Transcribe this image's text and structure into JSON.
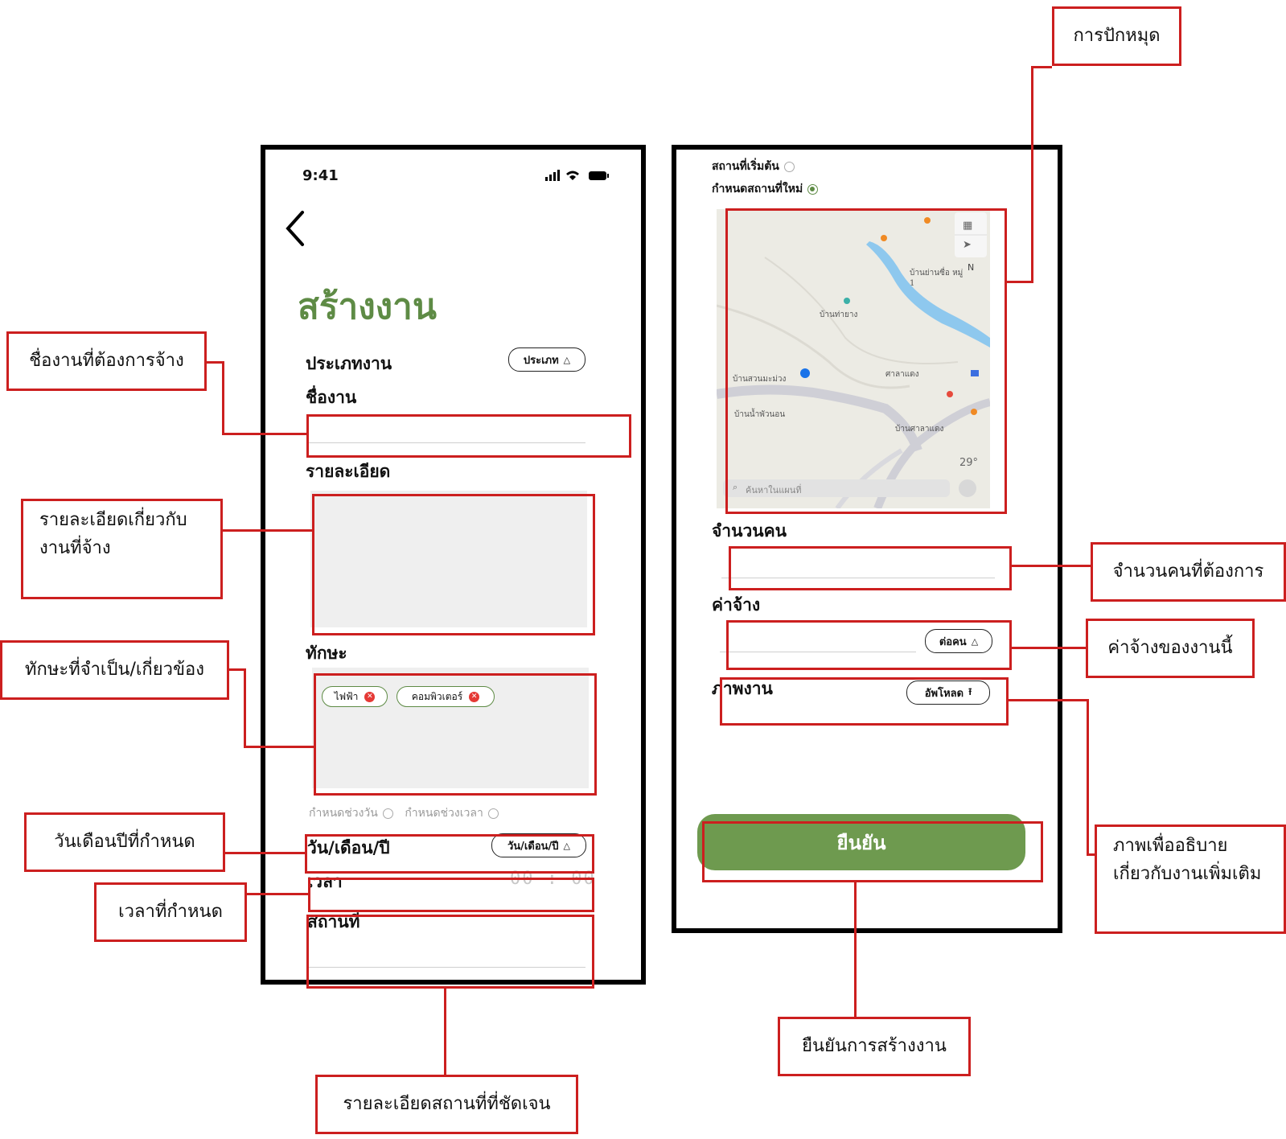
{
  "left_phone": {
    "status_time": "9:41",
    "title": "สร้างงาน",
    "job_type_label": "ประเภทงาน",
    "job_type_pill": "ประเภท",
    "job_name_label": "ชื่องาน",
    "details_label": "รายละเอียด",
    "skills_label": "ทักษะ",
    "skills": [
      "ไฟฟ้า",
      "คอมพิวเตอร์"
    ],
    "range_date_option": "กำหนดช่วงวัน",
    "range_time_option": "กำหนดช่วงเวลา",
    "date_label": "วัน/เดือน/ปี",
    "date_pill": "วัน/เดือน/ปี",
    "time_label": "เวลา",
    "time_value": "00 : 00",
    "place_label": "สถานที่"
  },
  "right_phone": {
    "start_place_option": "สถานที่เริ่มต้น",
    "new_place_option": "กำหนดสถานที่ใหม่",
    "map": {
      "search_placeholder": "ค้นหาในแผนที่",
      "labels": [
        "บ้านท่ายาง",
        "บ้านสวนมะม่วง",
        "บ้านน้ำพัวนอน",
        "บ้านศาลาแดง",
        "ศาลาแดง",
        "บ้านย่านซื่อ หมู่ 1"
      ],
      "temperature": "29°",
      "compass": "N"
    },
    "people_label": "จำนวนคน",
    "wage_label": "ค่าจ้าง",
    "wage_pill": "ต่อคน",
    "photo_label": "ภาพงาน",
    "upload_pill": "อัพโหลด",
    "confirm_button": "ยืนยัน"
  },
  "callouts": {
    "pin": "การปักหมุด",
    "job_name": "ชื่องานที่ต้องการจ้าง",
    "details": [
      "รายละเอียดเกี่ยวกับ",
      "งานที่จ้าง"
    ],
    "skills": "ทักษะที่จำเป็น/เกี่ยวข้อง",
    "date": "วันเดือนปีที่กำหนด",
    "time": "เวลาที่กำหนด",
    "place": "รายละเอียดสถานที่ที่ชัดเจน",
    "people": "จำนวนคนที่ต้องการ",
    "wage": "ค่าจ้างของงานนี้",
    "photo": [
      "ภาพเพื่ออธิบาย",
      "เกี่ยวกับงานเพิ่มเติม"
    ],
    "confirm": "ยืนยันการสร้างงาน"
  },
  "colors": {
    "accent_green": "#5e8b45",
    "button_green": "#6e9a4f",
    "annotation_red": "#cc1f1f",
    "chip_remove_red": "#e53935",
    "field_gray": "#efefef"
  }
}
